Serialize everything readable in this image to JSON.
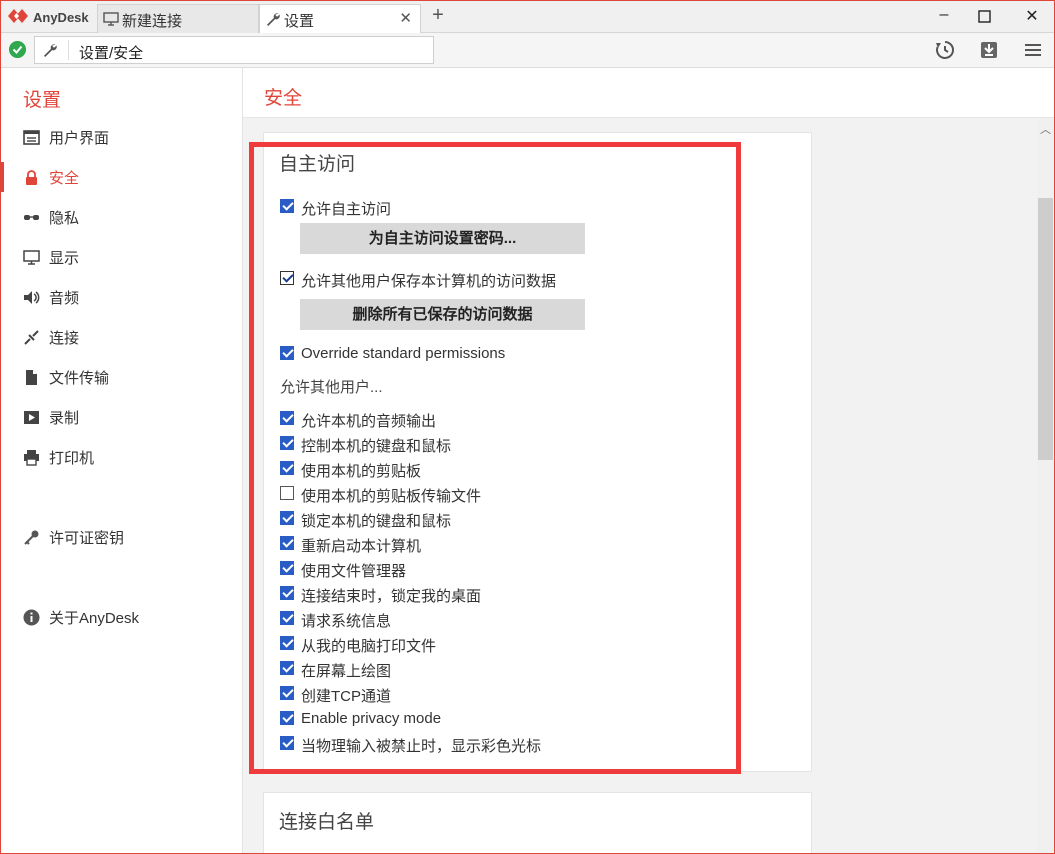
{
  "app": {
    "name": "AnyDesk"
  },
  "tabs": [
    {
      "label": "新建连接",
      "icon": "monitor-icon"
    },
    {
      "label": "设置",
      "icon": "wrench-icon"
    }
  ],
  "addressbar": {
    "path": "设置/安全"
  },
  "sidebar": {
    "title": "设置",
    "items": [
      {
        "label": "用户界面",
        "icon": "user-interface-icon"
      },
      {
        "label": "安全",
        "icon": "lock-icon"
      },
      {
        "label": "隐私",
        "icon": "glasses-icon"
      },
      {
        "label": "显示",
        "icon": "display-icon"
      },
      {
        "label": "音频",
        "icon": "speaker-icon"
      },
      {
        "label": "连接",
        "icon": "connection-icon"
      },
      {
        "label": "文件传输",
        "icon": "file-icon"
      },
      {
        "label": "录制",
        "icon": "record-icon"
      },
      {
        "label": "打印机",
        "icon": "printer-icon"
      },
      {
        "label": "许可证密钥",
        "icon": "key-icon"
      },
      {
        "label": "关于AnyDesk",
        "icon": "info-icon"
      }
    ]
  },
  "main": {
    "title": "安全",
    "panel1": {
      "title": "自主访问",
      "allow_unattended": "允许自主访问",
      "set_password_button": "为自主访问设置密码...",
      "allow_save_access": "允许其他用户保存本计算机的访问数据",
      "delete_saved_button": "删除所有已保存的访问数据",
      "override_permissions": "Override standard permissions",
      "allow_others_label": "允许其他用户...",
      "permissions": [
        {
          "label": "允许本机的音频输出",
          "checked": true
        },
        {
          "label": "控制本机的键盘和鼠标",
          "checked": true
        },
        {
          "label": "使用本机的剪贴板",
          "checked": true
        },
        {
          "label": "使用本机的剪贴板传输文件",
          "checked": false
        },
        {
          "label": "锁定本机的键盘和鼠标",
          "checked": true
        },
        {
          "label": "重新启动本计算机",
          "checked": true
        },
        {
          "label": "使用文件管理器",
          "checked": true
        },
        {
          "label": "连接结束时，锁定我的桌面",
          "checked": true
        },
        {
          "label": "请求系统信息",
          "checked": true
        },
        {
          "label": "从我的电脑打印文件",
          "checked": true
        },
        {
          "label": "在屏幕上绘图",
          "checked": true
        },
        {
          "label": "创建TCP通道",
          "checked": true
        },
        {
          "label": "Enable privacy mode",
          "checked": true
        },
        {
          "label": "当物理输入被禁止时，显示彩色光标",
          "checked": true
        }
      ]
    },
    "panel2": {
      "title": "连接白名单"
    }
  },
  "colors": {
    "accent": "#e0453a",
    "checkbox": "#2a5cc5",
    "highlight": "#ef3b3b"
  }
}
